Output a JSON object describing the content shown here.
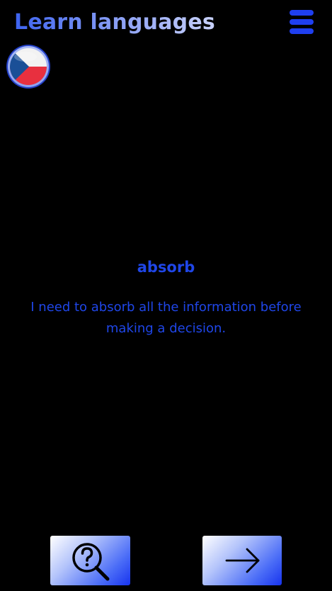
{
  "header": {
    "title": "Learn languages"
  },
  "icons": {
    "menu": "hamburger-menu-icon",
    "flag": "czech-flag-icon",
    "hint": "search-question-icon",
    "next": "arrow-right-icon"
  },
  "colors": {
    "background": "#000000",
    "accent": "#1f46e8",
    "menu": "#1f3ff0",
    "flag_red": "#e8303f",
    "flag_blue": "#1a4f97",
    "flag_white": "#f2f2f2"
  },
  "card": {
    "word": "absorb",
    "sentence": "I need to absorb all the information before making a decision."
  }
}
